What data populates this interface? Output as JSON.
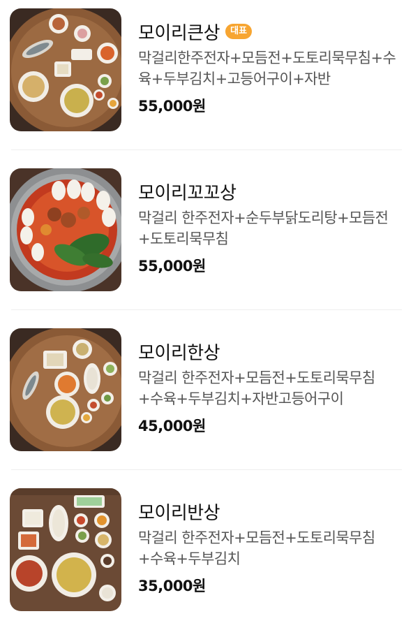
{
  "menu": {
    "items": [
      {
        "name": "모이리큰상",
        "badge": "대표",
        "description": "막걸리한주전자+모듬전+도토리묵무침+수육+두부김치+고등어구이+자반",
        "price": "55,000원",
        "image": "food-platter-image"
      },
      {
        "name": "모이리꼬꼬상",
        "badge": "",
        "description": "막걸리 한주전자+순두부닭도리탕+모듬전+도토리묵무침",
        "price": "55,000원",
        "image": "stew-pot-image"
      },
      {
        "name": "모이리한상",
        "badge": "",
        "description": "막걸리 한주전자+모듬전+도토리묵무침+수육+두부김치+자반고등어구이",
        "price": "45,000원",
        "image": "food-platter-image"
      },
      {
        "name": "모이리반상",
        "badge": "",
        "description": "막걸리 한주전자+모듬전+도토리묵무침+수육+두부김치",
        "price": "35,000원",
        "image": "food-table-image"
      }
    ]
  },
  "colors": {
    "badge": "#f7a531",
    "divider": "#eeeeee",
    "price": "#111111"
  }
}
